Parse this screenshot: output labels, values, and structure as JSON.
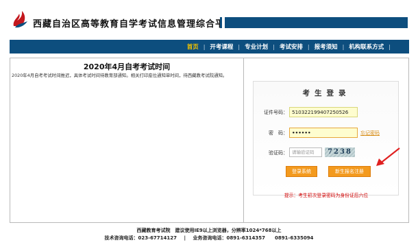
{
  "header": {
    "site_title": "西藏自治区高等教育自学考试信息管理综合平台",
    "logo_icon": "flame-logo-icon",
    "brand_color": "#0d4e7e"
  },
  "nav": {
    "items": [
      {
        "label": "首页",
        "active": true
      },
      {
        "label": "开考课程",
        "active": false
      },
      {
        "label": "专业计划",
        "active": false
      },
      {
        "label": "考试安排",
        "active": false
      },
      {
        "label": "报考须知",
        "active": false
      },
      {
        "label": "机构联系方式",
        "active": false
      }
    ],
    "active_color": "#f2c200"
  },
  "notice": {
    "title": "2020年4月自考考试时间",
    "body": "2020年4月自考考试时间推迟，具体考试时间待教育部通知。相关打印座位通知单时间，待西藏教考试院通知。"
  },
  "login": {
    "title": "考生登录",
    "id_label": "证件号码：",
    "id_value": "510322199407250526",
    "password_label": "密　码：",
    "password_value": "••••••",
    "forgot_label": "忘记密码",
    "captcha_label": "验证码：",
    "captcha_placeholder": "请输验证码",
    "captcha_text": "7238",
    "login_button": "登录系统",
    "register_button": "新生报名注册",
    "hint": "提示：考生初次登录密码为身份证后六位",
    "accent_color": "#f39a1e"
  },
  "footer": {
    "line1": "西藏教育考试院　建议使用IE9以上浏览器，分辨率1024*768以上",
    "tech_label": "技术咨询电话：023-67714127",
    "sep": "|",
    "biz_label": "业务咨询电话：0891-6314357　　0891-6335094"
  }
}
